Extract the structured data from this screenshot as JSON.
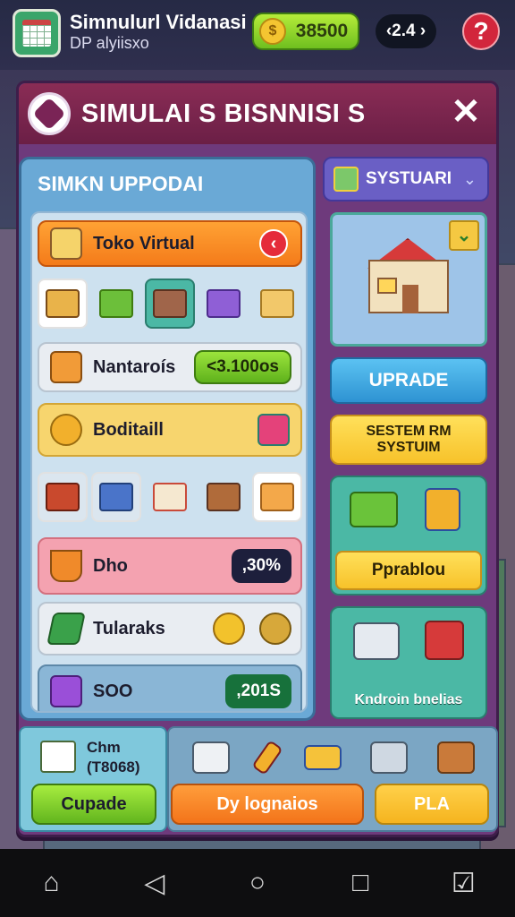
{
  "status": {
    "app_title": "Simnulurl Vidanasi",
    "app_subtitle": "DP alyiisxo",
    "coins": "38500",
    "coin_symbol": "$",
    "time": "‹2.4 ›",
    "help": "?"
  },
  "panel": {
    "title": "SIMULAI S BISNNISI S",
    "close": "✕"
  },
  "left": {
    "title": "SIMKN UPPODAI",
    "toko": {
      "label": "Toko Virtual",
      "arrow": "‹"
    },
    "row_nantarois": {
      "label": "Nantaroís",
      "value": "<3.100os"
    },
    "row_boditaill": {
      "label": "Boditaill"
    },
    "row_dho": {
      "label": "Dho",
      "value": ",30%"
    },
    "row_tularaks": {
      "label": "Tularaks"
    },
    "row_soo": {
      "label": "SOO",
      "value": ",201S"
    }
  },
  "right": {
    "dropdown": {
      "label": "SYSTUARI",
      "chevron": "⌄",
      "badge": "⌄"
    },
    "upgrade": "UPRADE",
    "system_btn": "SESTEM RM\nSYSTUIM",
    "card1_btn": "Pprablou",
    "card2_caption": "Kndroin bnelias"
  },
  "bottom": {
    "label": "Chm",
    "value": "(T8068)",
    "upgrade": "Cupade",
    "dy": "Dy lognaios",
    "pla": "PLA"
  },
  "nav": {
    "home": "⌂",
    "back": "◁",
    "circle": "○",
    "square": "□",
    "check": "☑"
  },
  "colors": {
    "panel": "#6e3a7c",
    "header": "#8a2c55",
    "accent_green": "#6fbf1f",
    "accent_orange": "#f47b1a",
    "accent_yellow": "#f7c22a",
    "accent_blue": "#2e93d2",
    "teal": "#4bb8a5"
  }
}
